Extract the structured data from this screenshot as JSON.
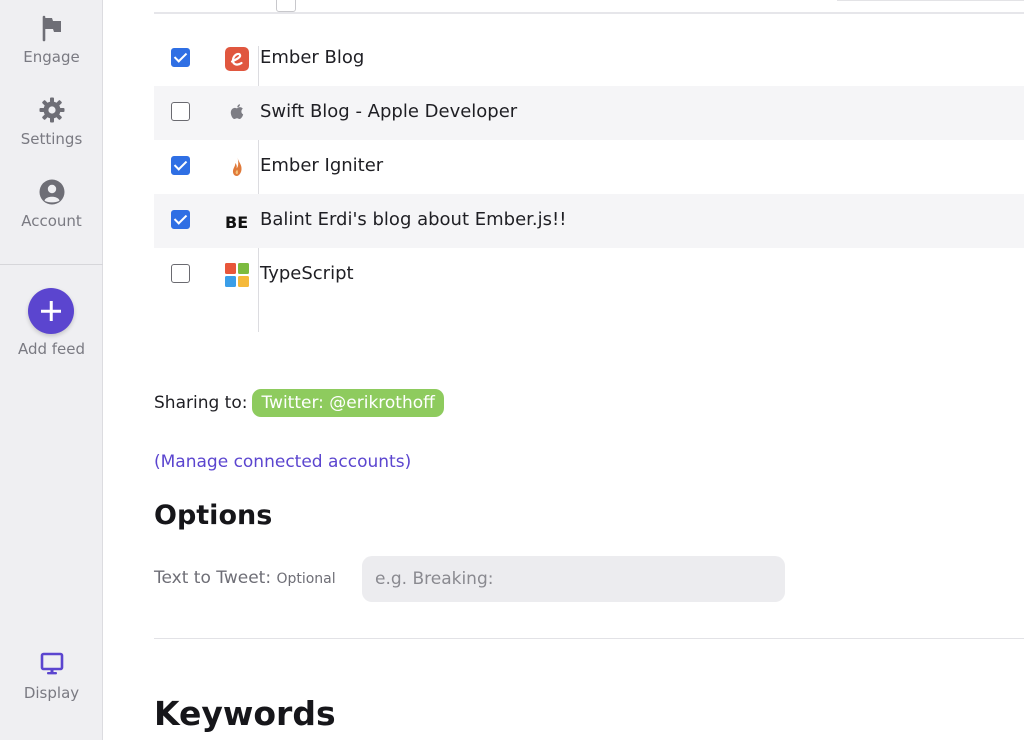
{
  "sidebar": {
    "items": [
      {
        "label": "Engage",
        "icon": "flag-icon"
      },
      {
        "label": "Settings",
        "icon": "gear-icon"
      },
      {
        "label": "Account",
        "icon": "user-circle-icon"
      }
    ],
    "add_feed_label": "Add feed",
    "display_label": "Display",
    "accent_color": "#5b45cf"
  },
  "feeds": [
    {
      "title": "Ember Blog",
      "checked": true,
      "icon": "ember-e-icon"
    },
    {
      "title": "Swift Blog - Apple Developer",
      "checked": false,
      "icon": "apple-icon"
    },
    {
      "title": "Ember Igniter",
      "checked": true,
      "icon": "flame-icon"
    },
    {
      "title": "Balint Erdi's blog about Ember.js!!",
      "checked": true,
      "icon": "be-initials-icon",
      "icon_text": "BE"
    },
    {
      "title": "TypeScript",
      "checked": false,
      "icon": "windows-squares-icon"
    }
  ],
  "sharing": {
    "label": "Sharing to:",
    "account": "Twitter: @erikrothoff",
    "pill_color": "#8ecb5e"
  },
  "manage_link": "(Manage connected accounts)",
  "options": {
    "heading": "Options",
    "tweet_label": "Text to Tweet:",
    "tweet_label_optional": "Optional",
    "tweet_placeholder": "e.g. Breaking:",
    "tweet_value": ""
  },
  "keywords_heading": "Keywords",
  "checkbox_color": "#2f6fe4"
}
